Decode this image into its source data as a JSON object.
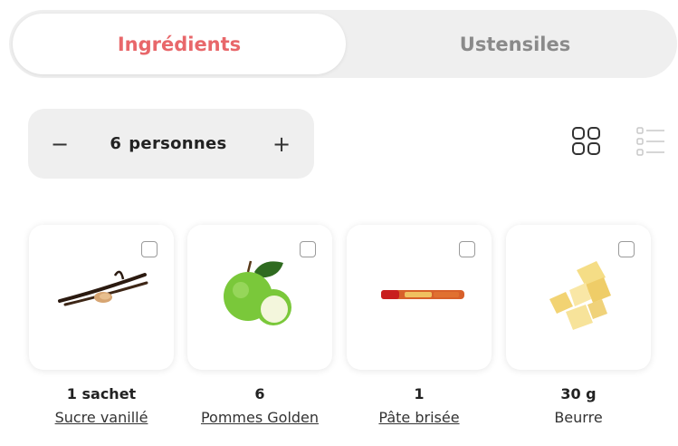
{
  "tabs": [
    {
      "label": "Ingrédients",
      "active": true
    },
    {
      "label": "Ustensiles",
      "active": false
    }
  ],
  "servings": {
    "minus": "−",
    "plus": "+",
    "count": "6",
    "unit": "personnes"
  },
  "view_toggle": {
    "grid_icon": "grid-icon",
    "list_icon": "list-icon",
    "active": "grid"
  },
  "ingredients": [
    {
      "quantity": "1 sachet",
      "name": "Sucre vanillé",
      "linked": true,
      "icon": "vanilla-icon",
      "checked": false
    },
    {
      "quantity": "6",
      "name": "Pommes Golden",
      "linked": true,
      "icon": "apple-icon",
      "checked": false
    },
    {
      "quantity": "1",
      "name": "Pâte brisée",
      "linked": true,
      "icon": "pastry-icon",
      "checked": false
    },
    {
      "quantity": "30 g",
      "name": "Beurre",
      "linked": false,
      "icon": "butter-icon",
      "checked": false
    }
  ],
  "colors": {
    "accent": "#e8676a",
    "inactive_tab": "#8a8a8a",
    "panel_bg": "#efefef"
  }
}
